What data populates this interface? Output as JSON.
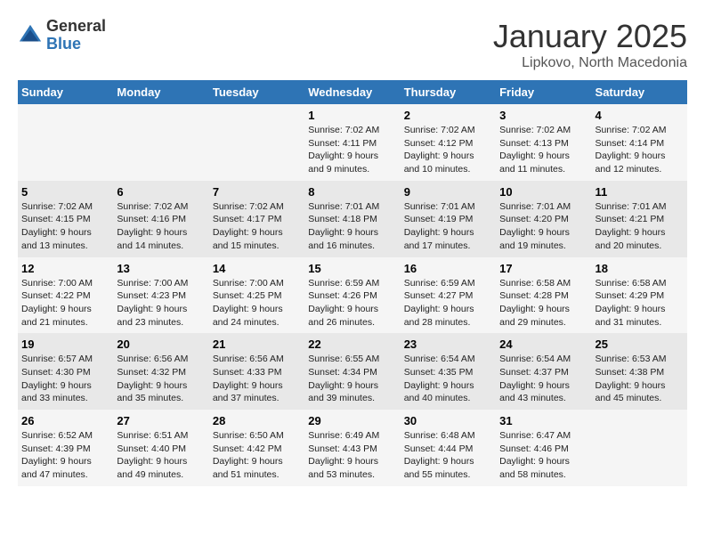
{
  "header": {
    "logo_line1": "General",
    "logo_line2": "Blue",
    "title": "January 2025",
    "subtitle": "Lipkovo, North Macedonia"
  },
  "weekdays": [
    "Sunday",
    "Monday",
    "Tuesday",
    "Wednesday",
    "Thursday",
    "Friday",
    "Saturday"
  ],
  "weeks": [
    [
      {
        "day": "",
        "info": ""
      },
      {
        "day": "",
        "info": ""
      },
      {
        "day": "",
        "info": ""
      },
      {
        "day": "1",
        "info": "Sunrise: 7:02 AM\nSunset: 4:11 PM\nDaylight: 9 hours\nand 9 minutes."
      },
      {
        "day": "2",
        "info": "Sunrise: 7:02 AM\nSunset: 4:12 PM\nDaylight: 9 hours\nand 10 minutes."
      },
      {
        "day": "3",
        "info": "Sunrise: 7:02 AM\nSunset: 4:13 PM\nDaylight: 9 hours\nand 11 minutes."
      },
      {
        "day": "4",
        "info": "Sunrise: 7:02 AM\nSunset: 4:14 PM\nDaylight: 9 hours\nand 12 minutes."
      }
    ],
    [
      {
        "day": "5",
        "info": "Sunrise: 7:02 AM\nSunset: 4:15 PM\nDaylight: 9 hours\nand 13 minutes."
      },
      {
        "day": "6",
        "info": "Sunrise: 7:02 AM\nSunset: 4:16 PM\nDaylight: 9 hours\nand 14 minutes."
      },
      {
        "day": "7",
        "info": "Sunrise: 7:02 AM\nSunset: 4:17 PM\nDaylight: 9 hours\nand 15 minutes."
      },
      {
        "day": "8",
        "info": "Sunrise: 7:01 AM\nSunset: 4:18 PM\nDaylight: 9 hours\nand 16 minutes."
      },
      {
        "day": "9",
        "info": "Sunrise: 7:01 AM\nSunset: 4:19 PM\nDaylight: 9 hours\nand 17 minutes."
      },
      {
        "day": "10",
        "info": "Sunrise: 7:01 AM\nSunset: 4:20 PM\nDaylight: 9 hours\nand 19 minutes."
      },
      {
        "day": "11",
        "info": "Sunrise: 7:01 AM\nSunset: 4:21 PM\nDaylight: 9 hours\nand 20 minutes."
      }
    ],
    [
      {
        "day": "12",
        "info": "Sunrise: 7:00 AM\nSunset: 4:22 PM\nDaylight: 9 hours\nand 21 minutes."
      },
      {
        "day": "13",
        "info": "Sunrise: 7:00 AM\nSunset: 4:23 PM\nDaylight: 9 hours\nand 23 minutes."
      },
      {
        "day": "14",
        "info": "Sunrise: 7:00 AM\nSunset: 4:25 PM\nDaylight: 9 hours\nand 24 minutes."
      },
      {
        "day": "15",
        "info": "Sunrise: 6:59 AM\nSunset: 4:26 PM\nDaylight: 9 hours\nand 26 minutes."
      },
      {
        "day": "16",
        "info": "Sunrise: 6:59 AM\nSunset: 4:27 PM\nDaylight: 9 hours\nand 28 minutes."
      },
      {
        "day": "17",
        "info": "Sunrise: 6:58 AM\nSunset: 4:28 PM\nDaylight: 9 hours\nand 29 minutes."
      },
      {
        "day": "18",
        "info": "Sunrise: 6:58 AM\nSunset: 4:29 PM\nDaylight: 9 hours\nand 31 minutes."
      }
    ],
    [
      {
        "day": "19",
        "info": "Sunrise: 6:57 AM\nSunset: 4:30 PM\nDaylight: 9 hours\nand 33 minutes."
      },
      {
        "day": "20",
        "info": "Sunrise: 6:56 AM\nSunset: 4:32 PM\nDaylight: 9 hours\nand 35 minutes."
      },
      {
        "day": "21",
        "info": "Sunrise: 6:56 AM\nSunset: 4:33 PM\nDaylight: 9 hours\nand 37 minutes."
      },
      {
        "day": "22",
        "info": "Sunrise: 6:55 AM\nSunset: 4:34 PM\nDaylight: 9 hours\nand 39 minutes."
      },
      {
        "day": "23",
        "info": "Sunrise: 6:54 AM\nSunset: 4:35 PM\nDaylight: 9 hours\nand 40 minutes."
      },
      {
        "day": "24",
        "info": "Sunrise: 6:54 AM\nSunset: 4:37 PM\nDaylight: 9 hours\nand 43 minutes."
      },
      {
        "day": "25",
        "info": "Sunrise: 6:53 AM\nSunset: 4:38 PM\nDaylight: 9 hours\nand 45 minutes."
      }
    ],
    [
      {
        "day": "26",
        "info": "Sunrise: 6:52 AM\nSunset: 4:39 PM\nDaylight: 9 hours\nand 47 minutes."
      },
      {
        "day": "27",
        "info": "Sunrise: 6:51 AM\nSunset: 4:40 PM\nDaylight: 9 hours\nand 49 minutes."
      },
      {
        "day": "28",
        "info": "Sunrise: 6:50 AM\nSunset: 4:42 PM\nDaylight: 9 hours\nand 51 minutes."
      },
      {
        "day": "29",
        "info": "Sunrise: 6:49 AM\nSunset: 4:43 PM\nDaylight: 9 hours\nand 53 minutes."
      },
      {
        "day": "30",
        "info": "Sunrise: 6:48 AM\nSunset: 4:44 PM\nDaylight: 9 hours\nand 55 minutes."
      },
      {
        "day": "31",
        "info": "Sunrise: 6:47 AM\nSunset: 4:46 PM\nDaylight: 9 hours\nand 58 minutes."
      },
      {
        "day": "",
        "info": ""
      }
    ]
  ]
}
